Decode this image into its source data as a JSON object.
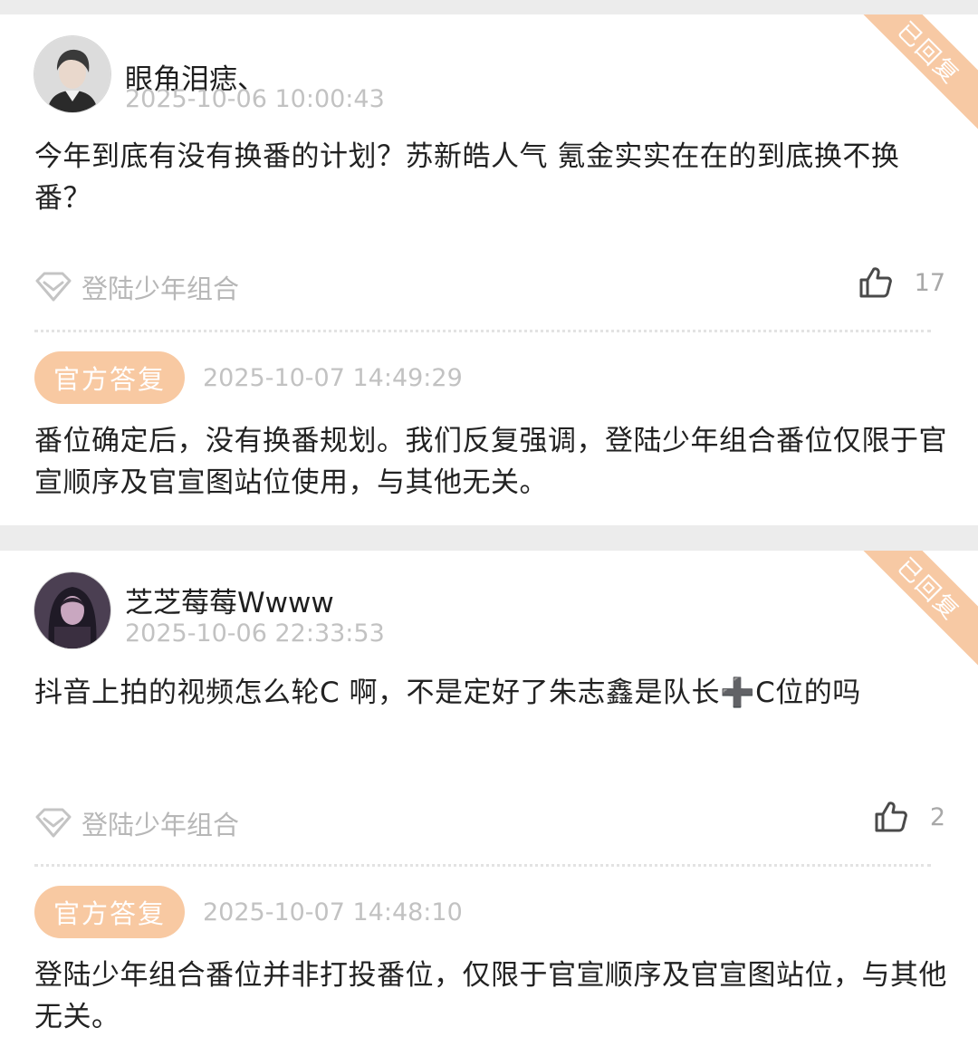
{
  "comments": [
    {
      "replied_badge": "已回复",
      "username": "眼角泪痣、",
      "time": "2025-10-06 10:00:43",
      "text": "今年到底有没有换番的计划？苏新皓人气 氪金实实在在的到底换不换番？",
      "tag": "登陆少年组合",
      "likes": "17",
      "official_label": "官方答复",
      "reply_time": "2025-10-07 14:49:29",
      "reply_text": "番位确定后，没有换番规划。我们反复强调，登陆少年组合番位仅限于官宣顺序及官宣图站位使用，与其他无关。"
    },
    {
      "replied_badge": "已回复",
      "username": "芝芝莓莓Wwww",
      "time": "2025-10-06 22:33:53",
      "text": "抖音上拍的视频怎么轮C  啊，不是定好了朱志鑫是队长➕C位的吗",
      "tag": "登陆少年组合",
      "likes": "2",
      "official_label": "官方答复",
      "reply_time": "2025-10-07 14:48:10",
      "reply_text": "登陆少年组合番位并非打投番位，仅限于官宣顺序及官宣图站位，与其他无关。"
    }
  ],
  "colors": {
    "background": "#ececec",
    "card": "#ffffff",
    "accent": "#f8c9a2",
    "muted_text": "#c2c2c2"
  }
}
